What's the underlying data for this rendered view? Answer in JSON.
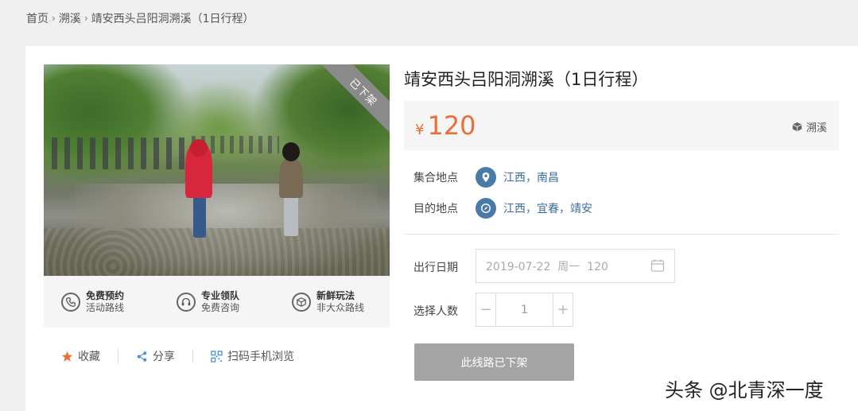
{
  "breadcrumb": {
    "items": [
      "首页",
      "溯溪",
      "靖安西头吕阳洞溯溪（1日行程）"
    ],
    "separator": "›"
  },
  "product": {
    "ribbon": "已下架",
    "title": "靖安西头吕阳洞溯溪（1日行程）",
    "currency": "¥",
    "price": "120",
    "category_tag": "溯溪",
    "accent_color": "#f06b35"
  },
  "features": [
    {
      "title": "免费预约",
      "sub": "活动路线",
      "icon": "phone-icon"
    },
    {
      "title": "专业领队",
      "sub": "免费咨询",
      "icon": "support-icon"
    },
    {
      "title": "新鲜玩法",
      "sub": "非大众路线",
      "icon": "cube-icon"
    }
  ],
  "actions": {
    "favorite": "收藏",
    "share": "分享",
    "mobile": "扫码手机浏览"
  },
  "meeting": {
    "label": "集合地点",
    "value": "江西，南昌"
  },
  "destination": {
    "label": "目的地点",
    "value": "江西，宜春，靖安"
  },
  "date": {
    "label": "出行日期",
    "value": "2019-07-22  周一  120"
  },
  "people": {
    "label": "选择人数",
    "minus": "−",
    "value": "1",
    "plus": "+"
  },
  "offline_button": "此线路已下架",
  "watermark": "头条 @北青深一度"
}
